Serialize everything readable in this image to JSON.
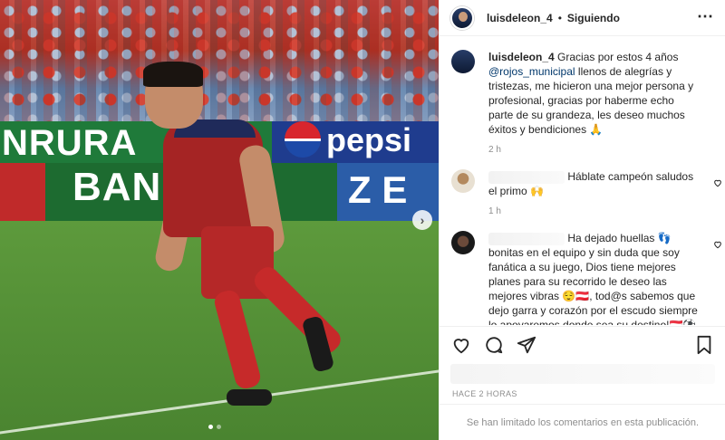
{
  "photo": {
    "ad_board_text": "NRURA",
    "ad_board_brand": "pepsi",
    "board2_text": "BAN   AL",
    "board2_blue_text": "Z E",
    "carousel_total": 2,
    "carousel_active": 1
  },
  "header": {
    "username": "luisdeleon_4",
    "separator": "•",
    "follow_status": "Siguiendo",
    "more_icon": "more-icon"
  },
  "caption": {
    "username": "luisdeleon_4",
    "text_before": "Gracias por estos 4 años ",
    "mention": "@rojos_municipal",
    "text_after": " llenos de alegrías y tristezas, me hicieron una mejor persona y profesional, gracias por haberme echo parte de su grandeza, les deseo muchos éxitos y bendiciones 🙏",
    "time": "2 h"
  },
  "comments": [
    {
      "text": "Háblate campeón saludos el primo 🙌",
      "time": "1 h"
    },
    {
      "text": "Ha dejado huellas 👣 bonitas en el equipo y sin duda que soy fanática a su juego, Dios tiene mejores planes para su recorrido le deseo las mejores vibras 😌🇦🇹, tod@s sabemos que dejo garra y corazón por el escudo siempre lo apoyaremos donde sea su destino!🇦🇹⚽❤👹"
    }
  ],
  "actions": {
    "like_icon": "heart-icon",
    "comment_icon": "comment-icon",
    "share_icon": "share-icon",
    "save_icon": "bookmark-icon"
  },
  "posted_time": "HACE 2 HORAS",
  "comments_limited": "Se han limitado los comentarios en esta publicación."
}
